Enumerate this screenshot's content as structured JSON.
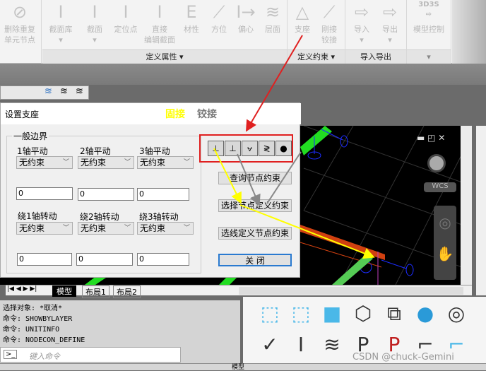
{
  "ribbon": {
    "items": [
      {
        "label": "删除重复\n单元节点",
        "icon": "delete-duplicate-icon"
      },
      {
        "label": "截面库",
        "icon": "section-library-icon"
      },
      {
        "label": "截面",
        "icon": "section-icon"
      },
      {
        "label": "定位点",
        "icon": "anchor-point-icon"
      },
      {
        "label": "直接\n编辑截面",
        "icon": "edit-section-icon"
      },
      {
        "label": "材性",
        "icon": "material-icon"
      },
      {
        "label": "方位",
        "icon": "orientation-icon"
      },
      {
        "label": "偏心",
        "icon": "eccentric-icon"
      },
      {
        "label": "层面",
        "icon": "layer-icon"
      },
      {
        "label": "支座",
        "icon": "support-icon"
      },
      {
        "label": "刚接\n铰接",
        "icon": "rigid-hinge-icon"
      },
      {
        "label": "导入",
        "icon": "import-icon"
      },
      {
        "label": "导出",
        "icon": "export-icon"
      },
      {
        "label": "模型控制",
        "icon": "model-control-icon",
        "logo": "3D3S"
      }
    ],
    "groups": [
      "定义属性 ▾",
      "定义约束 ▾",
      "导入导出",
      "▾"
    ]
  },
  "dialog": {
    "title": "设置支座",
    "fixed_label": "固接",
    "hinged_label": "铰接",
    "group_title": "一般边界",
    "trans_labels": [
      "1轴平动",
      "2轴平动",
      "3轴平动"
    ],
    "rot_labels": [
      "绕1轴转动",
      "绕2轴转动",
      "绕3轴转动"
    ],
    "trans_values": [
      "无约束",
      "无约束",
      "无约束"
    ],
    "rot_values": [
      "无约束",
      "无约束",
      "无约束"
    ],
    "trans_inputs": [
      "0",
      "0",
      "0"
    ],
    "rot_inputs": [
      "0",
      "0",
      "0"
    ],
    "support_buttons": [
      "fixed-support-icon",
      "pin-support-icon",
      "roller-support-icon",
      "spring-support-icon",
      "point-icon"
    ],
    "query_btn": "查询节点约束",
    "select_btn": "选择节点定义约束",
    "line_btn": "选线定义节点约束",
    "close_btn": "关 闭"
  },
  "viewport": {
    "wcs": "WCS"
  },
  "tabs": [
    "模型",
    "布局1",
    "布局2"
  ],
  "command": {
    "history": [
      "选择对象: *取消*",
      "命令: SHOWBYLAYER",
      "命令: UNITINFO",
      "命令: NODECON_DEFINE"
    ],
    "placeholder": "键入命令"
  },
  "status": {
    "model": "模型"
  },
  "watermark": "CSDN @chuck-Gemini",
  "colors": {
    "annotation_red": "#e02020",
    "highlight_yellow": "#ffff00",
    "grid_green": "#22dd22"
  }
}
